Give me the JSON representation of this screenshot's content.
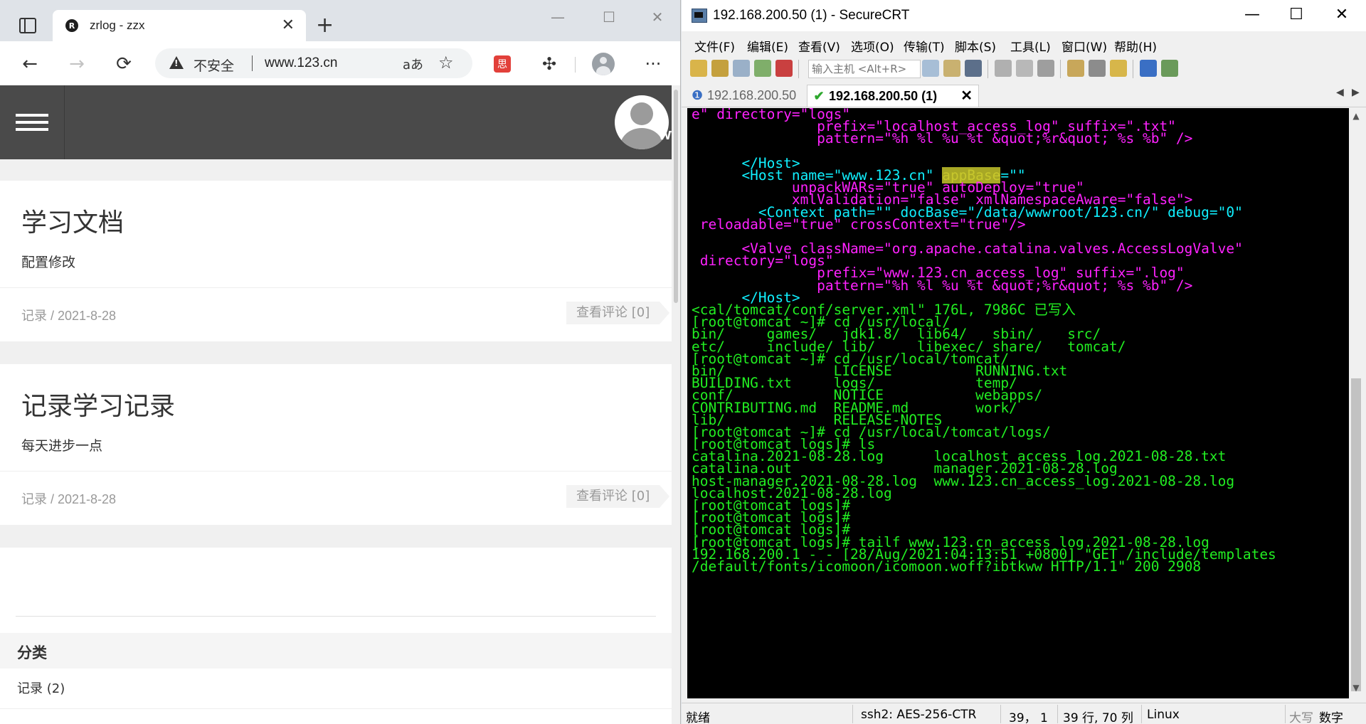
{
  "browser": {
    "tab": {
      "favicon_letter": "R",
      "title": "zrlog - zzx"
    },
    "new_tab_label": "+",
    "window_controls": {
      "minimize": "—",
      "maximize": "☐",
      "close": "✕"
    },
    "address": {
      "security_label": "不安全",
      "url": "www.123.cn",
      "read_aloud": "aあ"
    },
    "extension_badge": "思"
  },
  "site": {
    "header_avatar_text": "ww",
    "posts": [
      {
        "title": "学习文档",
        "excerpt": "配置修改",
        "meta": "记录 / 2021-8-28",
        "comments": "查看评论 [0]"
      },
      {
        "title": "记录学习记录",
        "excerpt": "每天进步一点",
        "meta": "记录 / 2021-8-28",
        "comments": "查看评论 [0]"
      }
    ],
    "widget": {
      "title": "分类",
      "category": "记录 (2)"
    }
  },
  "crt": {
    "title": "192.168.200.50 (1) - SecureCRT",
    "window_controls": {
      "minimize": "—",
      "maximize": "☐",
      "close": "✕"
    },
    "menu": [
      "文件(F)",
      "编辑(E)",
      "查看(V)",
      "选项(O)",
      "传输(T)",
      "脚本(S)",
      "工具(L)",
      "窗口(W)",
      "帮助(H)"
    ],
    "connect_placeholder": "输入主机 <Alt+R>",
    "tabs": [
      {
        "label": "192.168.200.50",
        "state": "disconnected"
      },
      {
        "label": "192.168.200.50 (1)",
        "state": "connected",
        "close": "✕"
      }
    ],
    "status": {
      "ready": "就绪",
      "cipher": "ssh2: AES-256-CTR",
      "cursor": "39，  1",
      "size": "39 行, 70 列",
      "os": "Linux",
      "caps": "大写",
      "num": "数字"
    }
  },
  "terminal": {
    "colors": {
      "magenta": "#ff22ff",
      "cyan": "#10f0ff",
      "green": "#22ee22",
      "highlight": "#a8a825"
    },
    "lines": [
      {
        "text": "e\" directory=\"logs\"",
        "color": "magenta"
      },
      {
        "text": "               prefix=\"localhost_access_log\" suffix=\".txt\"",
        "color": "magenta"
      },
      {
        "text": "               pattern=\"%h %l %u %t &quot;%r&quot; %s %b\" />",
        "color": "magenta"
      },
      {
        "text": "",
        "color": "green"
      },
      {
        "text": "      </Host>",
        "color": "cyan"
      },
      {
        "text": "      <Host name=\"www.123.cn\" ",
        "color": "cyan",
        "highlight": "appBase",
        "after": "=\"\""
      },
      {
        "text": "            unpackWARs=\"true\" autoDeploy=\"true\"",
        "color": "magenta"
      },
      {
        "text": "            xmlValidation=\"false\" xmlNamespaceAware=\"false\">",
        "color": "magenta"
      },
      {
        "text": "        <Context path=\"\" docBase=\"/data/wwwroot/123.cn/\" debug=\"0\"",
        "color": "cyan"
      },
      {
        "text": " reloadable=\"true\" crossContext=\"true\"/>",
        "color": "magenta"
      },
      {
        "text": "",
        "color": "green"
      },
      {
        "text": "      <Valve className=\"org.apache.catalina.valves.AccessLogValve\"",
        "color": "magenta"
      },
      {
        "text": " directory=\"logs\"",
        "color": "magenta"
      },
      {
        "text": "               prefix=\"www.123.cn_access_log\" suffix=\".log\"",
        "color": "magenta"
      },
      {
        "text": "               pattern=\"%h %l %u %t &quot;%r&quot; %s %b\" />",
        "color": "magenta"
      },
      {
        "text": "      </Host>",
        "color": "cyan"
      },
      {
        "text": "<cal/tomcat/conf/server.xml\" 176L, 7986C 已写入",
        "color": "green"
      },
      {
        "text": "[root@tomcat ~]# cd /usr/local/",
        "color": "green"
      },
      {
        "text": "bin/     games/   jdk1.8/  lib64/   sbin/    src/",
        "color": "green"
      },
      {
        "text": "etc/     include/ lib/     libexec/ share/   tomcat/",
        "color": "green"
      },
      {
        "text": "[root@tomcat ~]# cd /usr/local/tomcat/",
        "color": "green"
      },
      {
        "text": "bin/             LICENSE          RUNNING.txt",
        "color": "green"
      },
      {
        "text": "BUILDING.txt     logs/            temp/",
        "color": "green"
      },
      {
        "text": "conf/            NOTICE           webapps/",
        "color": "green"
      },
      {
        "text": "CONTRIBUTING.md  README.md        work/",
        "color": "green"
      },
      {
        "text": "lib/             RELEASE-NOTES",
        "color": "green"
      },
      {
        "text": "[root@tomcat ~]# cd /usr/local/tomcat/logs/",
        "color": "green"
      },
      {
        "text": "[root@tomcat logs]# ls",
        "color": "green"
      },
      {
        "text": "catalina.2021-08-28.log      localhost_access_log.2021-08-28.txt",
        "color": "green"
      },
      {
        "text": "catalina.out                 manager.2021-08-28.log",
        "color": "green"
      },
      {
        "text": "host-manager.2021-08-28.log  www.123.cn_access_log.2021-08-28.log",
        "color": "green"
      },
      {
        "text": "localhost.2021-08-28.log",
        "color": "green"
      },
      {
        "text": "[root@tomcat logs]#",
        "color": "green"
      },
      {
        "text": "[root@tomcat logs]#",
        "color": "green"
      },
      {
        "text": "[root@tomcat logs]#",
        "color": "green"
      },
      {
        "text": "[root@tomcat logs]# tailf www.123.cn_access_log.2021-08-28.log",
        "color": "green"
      },
      {
        "text": "192.168.200.1 - - [28/Aug/2021:04:13:51 +0800] \"GET /include/templates",
        "color": "green"
      },
      {
        "text": "/default/fonts/icomoon/icomoon.woff?ibtkww HTTP/1.1\" 200 2908",
        "color": "green"
      }
    ]
  }
}
